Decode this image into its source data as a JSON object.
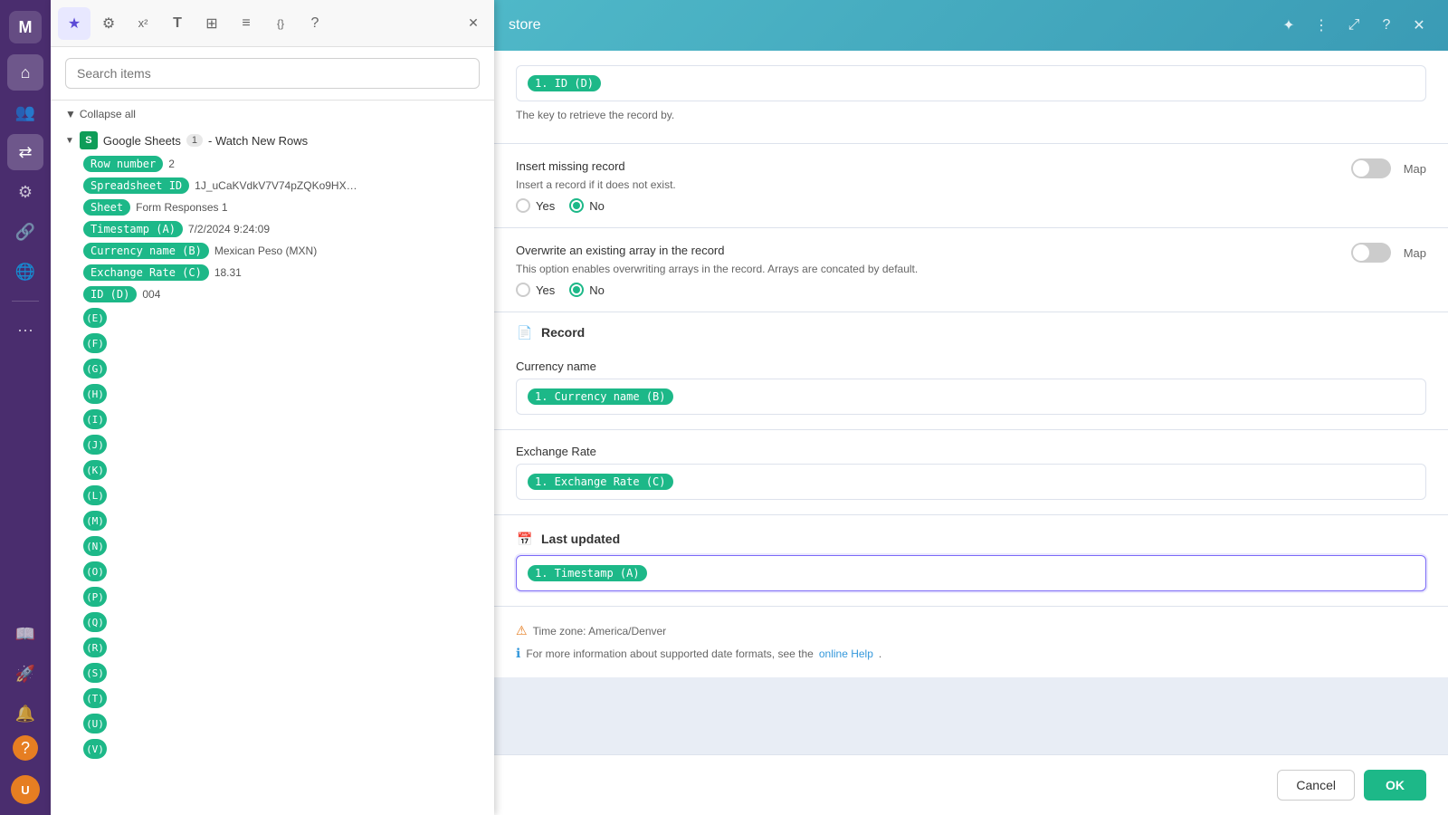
{
  "app": {
    "title": "store"
  },
  "sidebar": {
    "icons": [
      {
        "name": "home-icon",
        "symbol": "⌂"
      },
      {
        "name": "users-icon",
        "symbol": "👥"
      },
      {
        "name": "share-icon",
        "symbol": "⇄"
      },
      {
        "name": "integration-icon",
        "symbol": "⚙"
      },
      {
        "name": "link-icon",
        "symbol": "🔗"
      },
      {
        "name": "globe-icon",
        "symbol": "🌐"
      },
      {
        "name": "more-icon",
        "symbol": "⋯"
      },
      {
        "name": "docs-icon",
        "symbol": "📖"
      },
      {
        "name": "rocket-icon",
        "symbol": "🚀"
      },
      {
        "name": "bell-icon",
        "symbol": "🔔"
      },
      {
        "name": "help-icon",
        "symbol": "?"
      }
    ]
  },
  "panel": {
    "tabs": [
      {
        "name": "favorites-tab",
        "symbol": "★",
        "active": true
      },
      {
        "name": "settings-tab",
        "symbol": "⚙",
        "active": false
      },
      {
        "name": "formula-tab",
        "symbol": "x²",
        "active": false
      },
      {
        "name": "text-tab",
        "symbol": "T",
        "active": false
      },
      {
        "name": "grid-tab",
        "symbol": "⊞",
        "active": false
      },
      {
        "name": "table-tab",
        "symbol": "≡",
        "active": false
      },
      {
        "name": "code-tab",
        "symbol": "{}",
        "active": false
      },
      {
        "name": "help-tab",
        "symbol": "?",
        "active": false
      }
    ],
    "search_placeholder": "Search items",
    "collapse_all_label": "Collapse all",
    "source": {
      "icon": "S",
      "name": "Google Sheets",
      "badge": "1",
      "subtitle": "- Watch New Rows"
    },
    "items": [
      {
        "label": "Row number",
        "tag_type": "green",
        "value": "2",
        "name": "row-number-item"
      },
      {
        "label": "Spreadsheet ID",
        "tag_type": "green",
        "value": "1J_uCaKVdkV7V74pZQKo9HXoFSw...",
        "name": "spreadsheet-id-item"
      },
      {
        "label": "Sheet",
        "tag_type": "green",
        "value": "Form Responses 1",
        "name": "sheet-item"
      },
      {
        "label": "Timestamp (A)",
        "tag_type": "green",
        "value": "7/2/2024 9:24:09",
        "name": "timestamp-a-item"
      },
      {
        "label": "Currency name (B)",
        "tag_type": "green",
        "value": "Mexican Peso (MXN)",
        "name": "currency-name-b-item"
      },
      {
        "label": "Exchange Rate (C)",
        "tag_type": "green",
        "value": "18.31",
        "name": "exchange-rate-c-item"
      },
      {
        "label": "ID (D)",
        "tag_type": "green",
        "value": "004",
        "name": "id-d-item"
      },
      {
        "label": "(E)",
        "tag_type": "green",
        "value": "",
        "name": "e-item"
      },
      {
        "label": "(F)",
        "tag_type": "green",
        "value": "",
        "name": "f-item"
      },
      {
        "label": "(G)",
        "tag_type": "green",
        "value": "",
        "name": "g-item"
      },
      {
        "label": "(H)",
        "tag_type": "green",
        "value": "",
        "name": "h-item"
      },
      {
        "label": "(I)",
        "tag_type": "green",
        "value": "",
        "name": "i-item"
      },
      {
        "label": "(J)",
        "tag_type": "green",
        "value": "",
        "name": "j-item"
      },
      {
        "label": "(K)",
        "tag_type": "green",
        "value": "",
        "name": "k-item"
      },
      {
        "label": "(L)",
        "tag_type": "green",
        "value": "",
        "name": "l-item"
      },
      {
        "label": "(M)",
        "tag_type": "green",
        "value": "",
        "name": "m-item"
      },
      {
        "label": "(N)",
        "tag_type": "green",
        "value": "",
        "name": "n-item"
      },
      {
        "label": "(O)",
        "tag_type": "green",
        "value": "",
        "name": "o-item"
      },
      {
        "label": "(P)",
        "tag_type": "green",
        "value": "",
        "name": "p-item"
      },
      {
        "label": "(Q)",
        "tag_type": "green",
        "value": "",
        "name": "q-item"
      },
      {
        "label": "(R)",
        "tag_type": "green",
        "value": "",
        "name": "r-item"
      },
      {
        "label": "(S)",
        "tag_type": "green",
        "value": "",
        "name": "s-item"
      },
      {
        "label": "(T)",
        "tag_type": "green",
        "value": "",
        "name": "t-item"
      },
      {
        "label": "(U)",
        "tag_type": "green",
        "value": "",
        "name": "u-item"
      },
      {
        "label": "(V)",
        "tag_type": "green",
        "value": "",
        "name": "v-item"
      }
    ]
  },
  "main": {
    "title": "store",
    "fields": [
      {
        "name": "id-d-field",
        "tag_label": "1. ID (D)",
        "desc": "The key to retrieve the record by."
      },
      {
        "name": "insert-missing-record-field",
        "label": "Insert missing record",
        "desc": "Insert a record if it does not exist.",
        "toggle": false,
        "map_label": "Map",
        "radio_options": [
          {
            "label": "Yes",
            "selected": false
          },
          {
            "label": "No",
            "selected": true
          }
        ]
      },
      {
        "name": "overwrite-array-field",
        "label": "Overwrite an existing array in the record",
        "desc": "This option enables overwriting arrays in the record. Arrays are concated by default.",
        "toggle": false,
        "map_label": "Map",
        "radio_options": [
          {
            "label": "Yes",
            "selected": false
          },
          {
            "label": "No",
            "selected": true
          }
        ]
      }
    ],
    "record_section": {
      "title": "Record",
      "icon": "📄"
    },
    "currency_name_field": {
      "label": "Currency name",
      "tag": "1. Currency name (B)"
    },
    "exchange_rate_field": {
      "label": "Exchange Rate",
      "tag": "1. Exchange Rate (C)"
    },
    "last_updated_section": {
      "title": "Last updated",
      "icon": "📅",
      "tag": "1. Timestamp (A)"
    },
    "info_lines": [
      {
        "icon_type": "orange",
        "text": "Time zone: America/Denver"
      },
      {
        "icon_type": "blue",
        "text": "For more information about supported date formats, see the ",
        "link": "online Help",
        "text_after": "."
      }
    ],
    "buttons": {
      "cancel": "Cancel",
      "ok": "OK"
    }
  }
}
